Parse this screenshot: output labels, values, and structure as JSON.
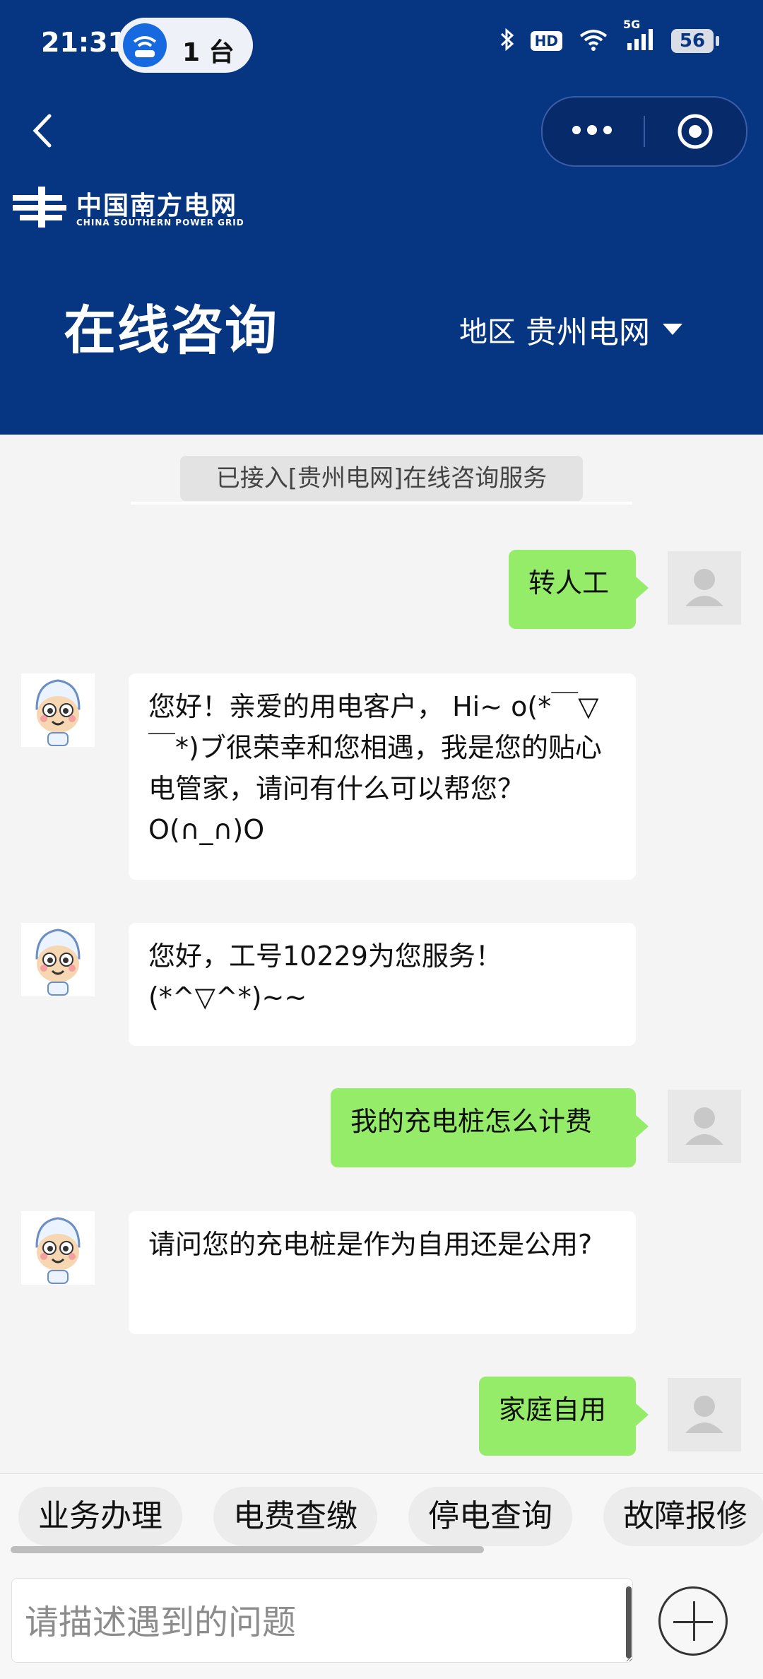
{
  "status_bar": {
    "time": "21:31",
    "wifi_devices": "1 台",
    "signal": "5G",
    "hd": "HD",
    "battery": "56"
  },
  "header": {
    "logo_cn": "中国南方电网",
    "logo_en": "CHINA SOUTHERN POWER GRID",
    "title": "在线咨询",
    "region_label": "地区",
    "region_value": "贵州电网",
    "colors": {
      "header_bg": "#063581",
      "user_bubble": "#95ec69"
    }
  },
  "chat": {
    "system_notice": "已接入[贵州电网]在线咨询服务",
    "messages": [
      {
        "from": "user",
        "text": "转人工"
      },
      {
        "from": "bot",
        "text": "您好！亲爱的用电客户， Hi~ o(*￣▽￣*)ブ很荣幸和您相遇，我是您的贴心电管家，请问有什么可以帮您？O(∩_∩)O"
      },
      {
        "from": "bot",
        "text": "您好，工号10229为您服务！(*^▽^*)~~"
      },
      {
        "from": "user",
        "text": "我的充电桩怎么计费"
      },
      {
        "from": "bot",
        "text": "请问您的充电桩是作为自用还是公用?"
      },
      {
        "from": "user",
        "text": "家庭自用"
      }
    ]
  },
  "quick_actions": [
    "业务办理",
    "电费查缴",
    "停电查询",
    "故障报修"
  ],
  "input": {
    "placeholder": "请描述遇到的问题"
  }
}
